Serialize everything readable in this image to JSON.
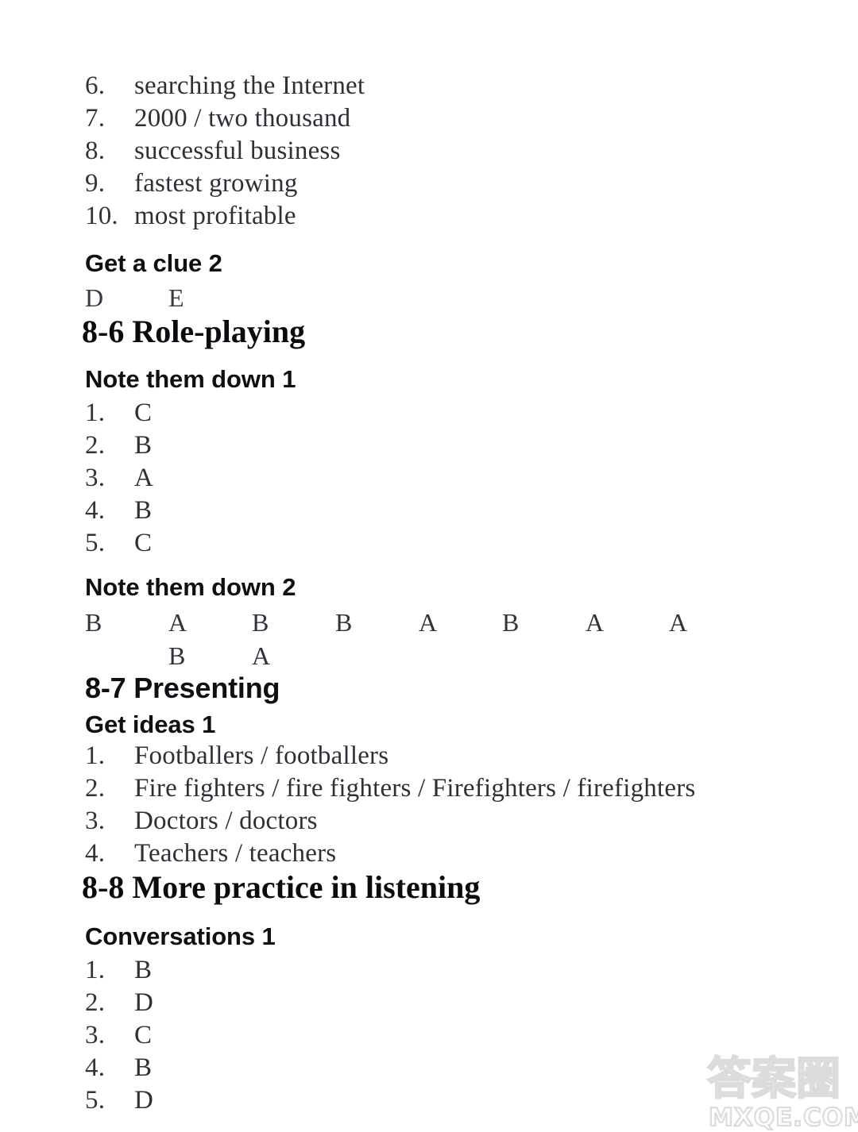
{
  "page": {
    "background_color": "#ffffff",
    "text_color": "#2b2b33"
  },
  "sections": [
    {
      "id": "continued-list",
      "type": "numbered-list",
      "items": [
        {
          "number": "6.",
          "text": "searching the Internet"
        },
        {
          "number": "7.",
          "text": "2000 / two thousand"
        },
        {
          "number": "8.",
          "text": "successful business"
        },
        {
          "number": "9.",
          "text": "fastest growing"
        },
        {
          "number": "10.",
          "text": "most profitable"
        }
      ]
    },
    {
      "id": "get-a-clue-2",
      "type": "heading-sans",
      "heading": "Get a clue 2",
      "letters": [
        "D",
        "E"
      ]
    },
    {
      "id": "unit-8-6",
      "type": "heading-serif",
      "heading": "8-6 Role-playing"
    },
    {
      "id": "note-them-down-1",
      "type": "heading-sans",
      "heading": "Note them down 1",
      "items": [
        {
          "number": "1.",
          "text": "C"
        },
        {
          "number": "2.",
          "text": "B"
        },
        {
          "number": "3.",
          "text": "A"
        },
        {
          "number": "4.",
          "text": "B"
        },
        {
          "number": "5.",
          "text": "C"
        }
      ]
    },
    {
      "id": "note-them-down-2",
      "type": "heading-sans",
      "heading": "Note them down 2",
      "row1": [
        "B",
        "A",
        "B",
        "B",
        "A",
        "B",
        "A",
        "A"
      ],
      "row2": [
        "",
        "B",
        "A"
      ]
    },
    {
      "id": "unit-8-7",
      "type": "heading-sans-large",
      "heading": "8-7 Presenting"
    },
    {
      "id": "get-ideas-1",
      "type": "heading-sans",
      "heading": "Get ideas 1",
      "items": [
        {
          "number": "1.",
          "text": "Footballers / footballers"
        },
        {
          "number": "2.",
          "text": "Fire fighters / fire fighters / Firefighters / firefighters"
        },
        {
          "number": "3.",
          "text": "Doctors / doctors"
        },
        {
          "number": "4.",
          "text": "Teachers / teachers"
        }
      ]
    },
    {
      "id": "unit-8-8",
      "type": "heading-serif",
      "heading": "8-8 More practice in listening"
    },
    {
      "id": "conversations-1",
      "type": "heading-sans",
      "heading": "Conversations 1",
      "items": [
        {
          "number": "1.",
          "text": "B"
        },
        {
          "number": "2.",
          "text": "D"
        },
        {
          "number": "3.",
          "text": "C"
        },
        {
          "number": "4.",
          "text": "B"
        },
        {
          "number": "5.",
          "text": "D"
        }
      ]
    }
  ],
  "watermark": {
    "characters": "答案圈",
    "domain": "MXQE.COM",
    "color": "#dcdcdc"
  }
}
